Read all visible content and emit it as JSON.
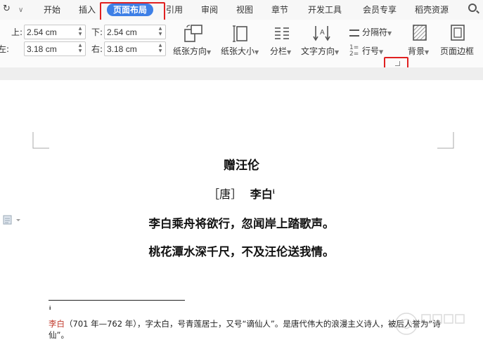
{
  "tabbar": {
    "tabs": [
      {
        "id": "start",
        "label": "开始"
      },
      {
        "id": "insert",
        "label": "插入"
      },
      {
        "id": "layout",
        "label": "页面布局"
      },
      {
        "id": "references",
        "label": "引用"
      },
      {
        "id": "review",
        "label": "审阅"
      },
      {
        "id": "view",
        "label": "视图"
      },
      {
        "id": "sections",
        "label": "章节"
      },
      {
        "id": "devtools",
        "label": "开发工具"
      },
      {
        "id": "member",
        "label": "会员专享"
      },
      {
        "id": "resources",
        "label": "稻壳资源"
      }
    ],
    "active_tab": "页面布局",
    "icons": [
      "refresh-icon",
      "quick-access-dropdown-icon",
      "search-icon"
    ]
  },
  "margins": {
    "top_label": "上:",
    "top_value": "2.54 cm",
    "bottom_label": "下:",
    "bottom_value": "2.54 cm",
    "left_label": "左:",
    "left_value": "3.18 cm",
    "right_label": "右:",
    "right_value": "3.18 cm"
  },
  "ribbon": {
    "orientation_label": "纸张方向",
    "size_label": "纸张大小",
    "columns_label": "分栏",
    "text_direction_label": "文字方向",
    "breaks_label": "分隔符",
    "line_numbers_label": "行号",
    "background_label": "背景",
    "page_border_label": "页面边框"
  },
  "document": {
    "title": "赠汪伦",
    "dynasty": "［唐］",
    "author": "李白",
    "footnote_ref": "i",
    "lines": [
      "李白乘舟将欲行，忽闻岸上踏歌声。",
      "桃花潭水深千尺，不及汪伦送我情。"
    ],
    "footnote_mark": "i",
    "footnote_name": "李白",
    "footnote_text": "（701 年—762 年），字太白，号青莲居士，又号“谪仙人”。是唐代伟大的浪漫主义诗人，被后人誉为“诗仙”。"
  },
  "colors": {
    "accent": "#3d7fe6",
    "highlight_box": "#e02020",
    "footnote_name": "#c0392b"
  }
}
